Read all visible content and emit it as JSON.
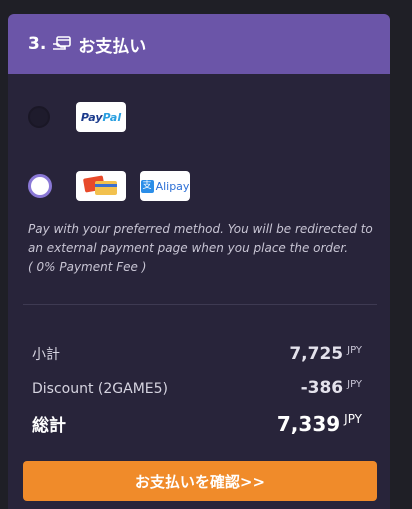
{
  "header": {
    "step_number": "3.",
    "title": "お支払い"
  },
  "payment_options": {
    "paypal": {
      "part1": "Pay",
      "part2": "Pal",
      "selected": false
    },
    "alipay": {
      "mark": "支",
      "label": "Alipay",
      "selected": true
    }
  },
  "description": {
    "line1": "Pay with your preferred method. You will be redirected to",
    "line2": "an external payment page when you place the order.",
    "line3": "( 0% Payment Fee )"
  },
  "summary": {
    "subtotal_label": "小計",
    "subtotal_value": "7,725",
    "subtotal_currency": "JPY",
    "discount_label": "Discount (2GAME5)",
    "discount_value": "-386",
    "discount_currency": "JPY",
    "total_label": "総計",
    "total_value": "7,339",
    "total_currency": "JPY"
  },
  "confirm_button": {
    "label": "お支払いを確認>>"
  },
  "colors": {
    "header_bg": "#6b55a8",
    "card_bg": "#28243a",
    "button_bg": "#f08b2a",
    "radio_selected": "#8a78d6"
  },
  "icons": {
    "header_icon": "card-hand-icon",
    "cards_logo": "credit-cards-icon"
  }
}
